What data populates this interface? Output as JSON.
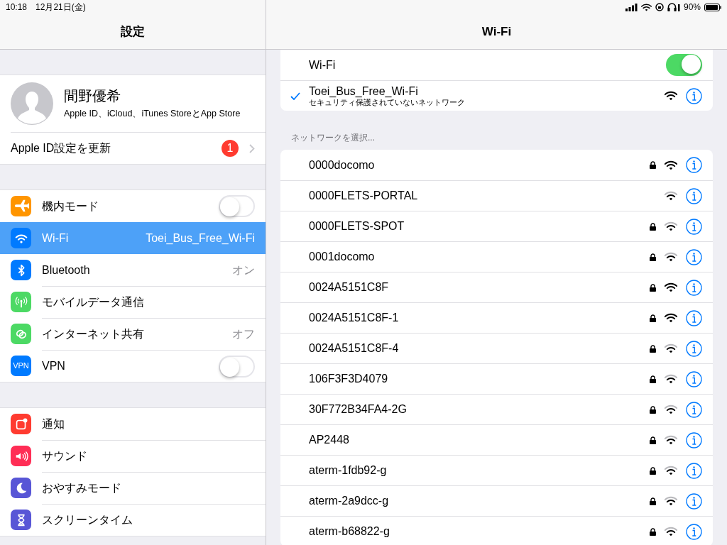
{
  "status_bar": {
    "time": "10:18",
    "date": "12月21日(金)",
    "battery": "90%"
  },
  "sidebar": {
    "title": "設定",
    "profile": {
      "name": "間野優希",
      "subtitle": "Apple ID、iCloud、iTunes StoreとApp Store"
    },
    "apple_id_row": {
      "label": "Apple ID設定を更新",
      "badge": "1"
    },
    "groups": [
      [
        {
          "kind": "toggle",
          "label": "機内モード",
          "on": false,
          "selected": false,
          "color": "#ff9500"
        },
        {
          "kind": "value",
          "label": "Wi-Fi",
          "value": "Toei_Bus_Free_Wi-Fi",
          "selected": true,
          "color": "#007aff"
        },
        {
          "kind": "value",
          "label": "Bluetooth",
          "value": "オン",
          "selected": false,
          "color": "#007aff"
        },
        {
          "kind": "plain",
          "label": "モバイルデータ通信",
          "selected": false,
          "color": "#4cd964"
        },
        {
          "kind": "value",
          "label": "インターネット共有",
          "value": "オフ",
          "selected": false,
          "color": "#4cd964"
        },
        {
          "kind": "toggle",
          "label": "VPN",
          "on": false,
          "selected": false,
          "color": "#007aff",
          "icon_text": "VPN"
        }
      ],
      [
        {
          "kind": "plain",
          "label": "通知",
          "selected": false,
          "color": "#ff3b30"
        },
        {
          "kind": "plain",
          "label": "サウンド",
          "selected": false,
          "color": "#ff2d55"
        },
        {
          "kind": "plain",
          "label": "おやすみモード",
          "selected": false,
          "color": "#5856d6"
        },
        {
          "kind": "plain",
          "label": "スクリーンタイム",
          "selected": false,
          "color": "#5856d6"
        }
      ]
    ]
  },
  "detail": {
    "title": "Wi-Fi",
    "wifi_toggle": {
      "label": "Wi-Fi",
      "on": true
    },
    "connected": {
      "name": "Toei_Bus_Free_Wi-Fi",
      "subtitle": "セキュリティ保護されていないネットワーク",
      "strong_signal": true
    },
    "section_header": "ネットワークを選択...",
    "networks": [
      {
        "name": "0000docomo",
        "locked": true,
        "strong_signal": true
      },
      {
        "name": "0000FLETS-PORTAL",
        "locked": false,
        "strong_signal": false
      },
      {
        "name": "0000FLETS-SPOT",
        "locked": true,
        "strong_signal": false
      },
      {
        "name": "0001docomo",
        "locked": true,
        "strong_signal": false
      },
      {
        "name": "0024A5151C8F",
        "locked": true,
        "strong_signal": true
      },
      {
        "name": "0024A5151C8F-1",
        "locked": true,
        "strong_signal": true
      },
      {
        "name": "0024A5151C8F-4",
        "locked": true,
        "strong_signal": false
      },
      {
        "name": "106F3F3D4079",
        "locked": true,
        "strong_signal": false
      },
      {
        "name": "30F772B34FA4-2G",
        "locked": true,
        "strong_signal": false
      },
      {
        "name": "AP2448",
        "locked": true,
        "strong_signal": false
      },
      {
        "name": "aterm-1fdb92-g",
        "locked": true,
        "strong_signal": false
      },
      {
        "name": "aterm-2a9dcc-g",
        "locked": true,
        "strong_signal": false
      },
      {
        "name": "aterm-b68822-g",
        "locked": true,
        "strong_signal": false
      }
    ]
  }
}
